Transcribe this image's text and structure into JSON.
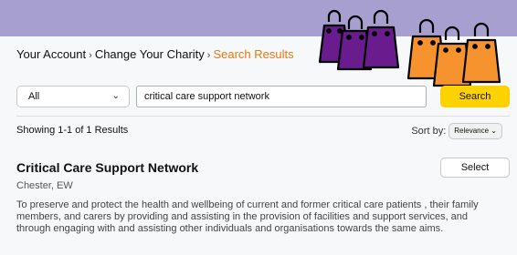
{
  "breadcrumb": {
    "items": [
      "Your Account",
      "Change Your Charity",
      "Search Results"
    ],
    "separator": "›"
  },
  "search": {
    "category": "All",
    "query": "critical care support network",
    "button_label": "Search"
  },
  "results": {
    "summary": "Showing 1-1 of 1 Results",
    "sort_label": "Sort by:",
    "sort_value": "Relevance",
    "items": [
      {
        "name": "Critical Care Support Network",
        "location": "Chester, EW",
        "description": "To preserve and protect the health and wellbeing of current and former critical care patients , their family members, and carers by providing and assisting in the provision of facilities and support services, and through engaging with and assisting other individuals and organisations towards the same aims.",
        "button_label": "Select"
      }
    ]
  },
  "colors": {
    "background": "#a89fd1",
    "accent": "#fcd200",
    "breadcrumb_current": "#e47911",
    "bag_purple": "#6a1b8e",
    "bag_orange": "#f7932f"
  },
  "decorations": {
    "icons": [
      "shopping-bag-icon"
    ]
  }
}
